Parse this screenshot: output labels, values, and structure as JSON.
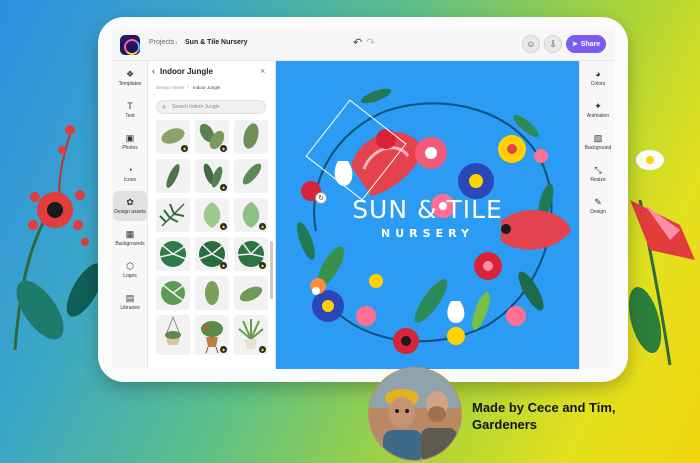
{
  "topbar": {
    "breadcrumb_projects": "Projects",
    "breadcrumb_separator": "›",
    "project_title": "Sun & Tile Nursery",
    "share_label": "Share"
  },
  "left_rail": {
    "items": [
      {
        "label": "Templates",
        "icon": "templates-icon"
      },
      {
        "label": "Text",
        "icon": "text-icon"
      },
      {
        "label": "Photos",
        "icon": "photos-icon"
      },
      {
        "label": "Icons",
        "icon": "icons-icon"
      },
      {
        "label": "Design assets",
        "icon": "design-assets-icon",
        "active": true
      },
      {
        "label": "Backgrounds",
        "icon": "backgrounds-icon"
      },
      {
        "label": "Logos",
        "icon": "logos-icon"
      },
      {
        "label": "Libraries",
        "icon": "libraries-icon"
      }
    ]
  },
  "panel": {
    "title": "Indoor Jungle",
    "breadcrumb_parent": "Design Assets",
    "breadcrumb_current": "Indoor Jungle",
    "search_placeholder": "Search Indoor Jungle"
  },
  "canvas": {
    "title_line1": "SUN & TILE",
    "title_line2": "NURSERY",
    "background_color": "#2b9bf4"
  },
  "right_rail": {
    "items": [
      {
        "label": "Colors",
        "icon": "colors-icon"
      },
      {
        "label": "Animation",
        "icon": "animation-icon"
      },
      {
        "label": "Background",
        "icon": "background-icon"
      },
      {
        "label": "Resize",
        "icon": "resize-icon"
      },
      {
        "label": "Design",
        "icon": "design-icon"
      }
    ]
  },
  "caption": {
    "line1": "Made by Cece and Tim,",
    "line2": "Gardeners"
  },
  "colors": {
    "accent": "#7b5cf0",
    "canvas_blue": "#2b9bf4"
  }
}
